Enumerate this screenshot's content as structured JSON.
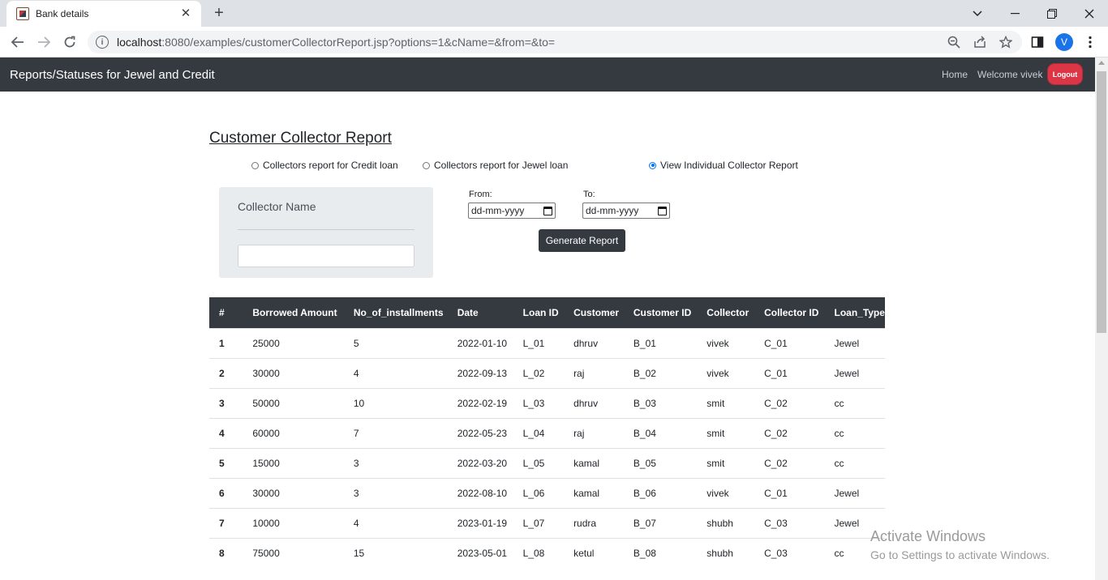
{
  "browser": {
    "tab_title": "Bank details",
    "url_host": "localhost",
    "url_rest": ":8080/examples/customerCollectorReport.jsp?options=1&cName=&from=&to=",
    "profile_initial": "V"
  },
  "navbar": {
    "brand": "Reports/Statuses for Jewel and Credit",
    "home": "Home",
    "welcome": "Welcome vivek",
    "logout": "Logout"
  },
  "page": {
    "title": "Customer Collector Report",
    "radios": [
      {
        "label": "Collectors report for Credit loan",
        "checked": false
      },
      {
        "label": "Collectors report for Jewel loan",
        "checked": false
      },
      {
        "label": "View Individual Collector Report",
        "checked": true
      }
    ],
    "collector_label": "Collector Name",
    "from_label": "From:",
    "to_label": "To:",
    "date_placeholder": "dd-mm-yyyy",
    "generate_button": "Generate Report"
  },
  "table": {
    "headers": [
      "#",
      "Borrowed Amount",
      "No_of_installments",
      "Date",
      "Loan ID",
      "Customer",
      "Customer ID",
      "Collector",
      "Collector ID",
      "Loan_Type"
    ],
    "rows": [
      [
        "1",
        "25000",
        "5",
        "2022-01-10",
        "L_01",
        "dhruv",
        "B_01",
        "vivek",
        "C_01",
        "Jewel"
      ],
      [
        "2",
        "30000",
        "4",
        "2022-09-13",
        "L_02",
        "raj",
        "B_02",
        "vivek",
        "C_01",
        "Jewel"
      ],
      [
        "3",
        "50000",
        "10",
        "2022-02-19",
        "L_03",
        "dhruv",
        "B_03",
        "smit",
        "C_02",
        "cc"
      ],
      [
        "4",
        "60000",
        "7",
        "2022-05-23",
        "L_04",
        "raj",
        "B_04",
        "smit",
        "C_02",
        "cc"
      ],
      [
        "5",
        "15000",
        "3",
        "2022-03-20",
        "L_05",
        "kamal",
        "B_05",
        "smit",
        "C_02",
        "cc"
      ],
      [
        "6",
        "30000",
        "3",
        "2022-08-10",
        "L_06",
        "kamal",
        "B_06",
        "vivek",
        "C_01",
        "Jewel"
      ],
      [
        "7",
        "10000",
        "4",
        "2023-01-19",
        "L_07",
        "rudra",
        "B_07",
        "shubh",
        "C_03",
        "Jewel"
      ],
      [
        "8",
        "75000",
        "15",
        "2023-05-01",
        "L_08",
        "ketul",
        "B_08",
        "shubh",
        "C_03",
        "cc"
      ]
    ]
  },
  "watermark": {
    "line1": "Activate Windows",
    "line2": "Go to Settings to activate Windows."
  }
}
